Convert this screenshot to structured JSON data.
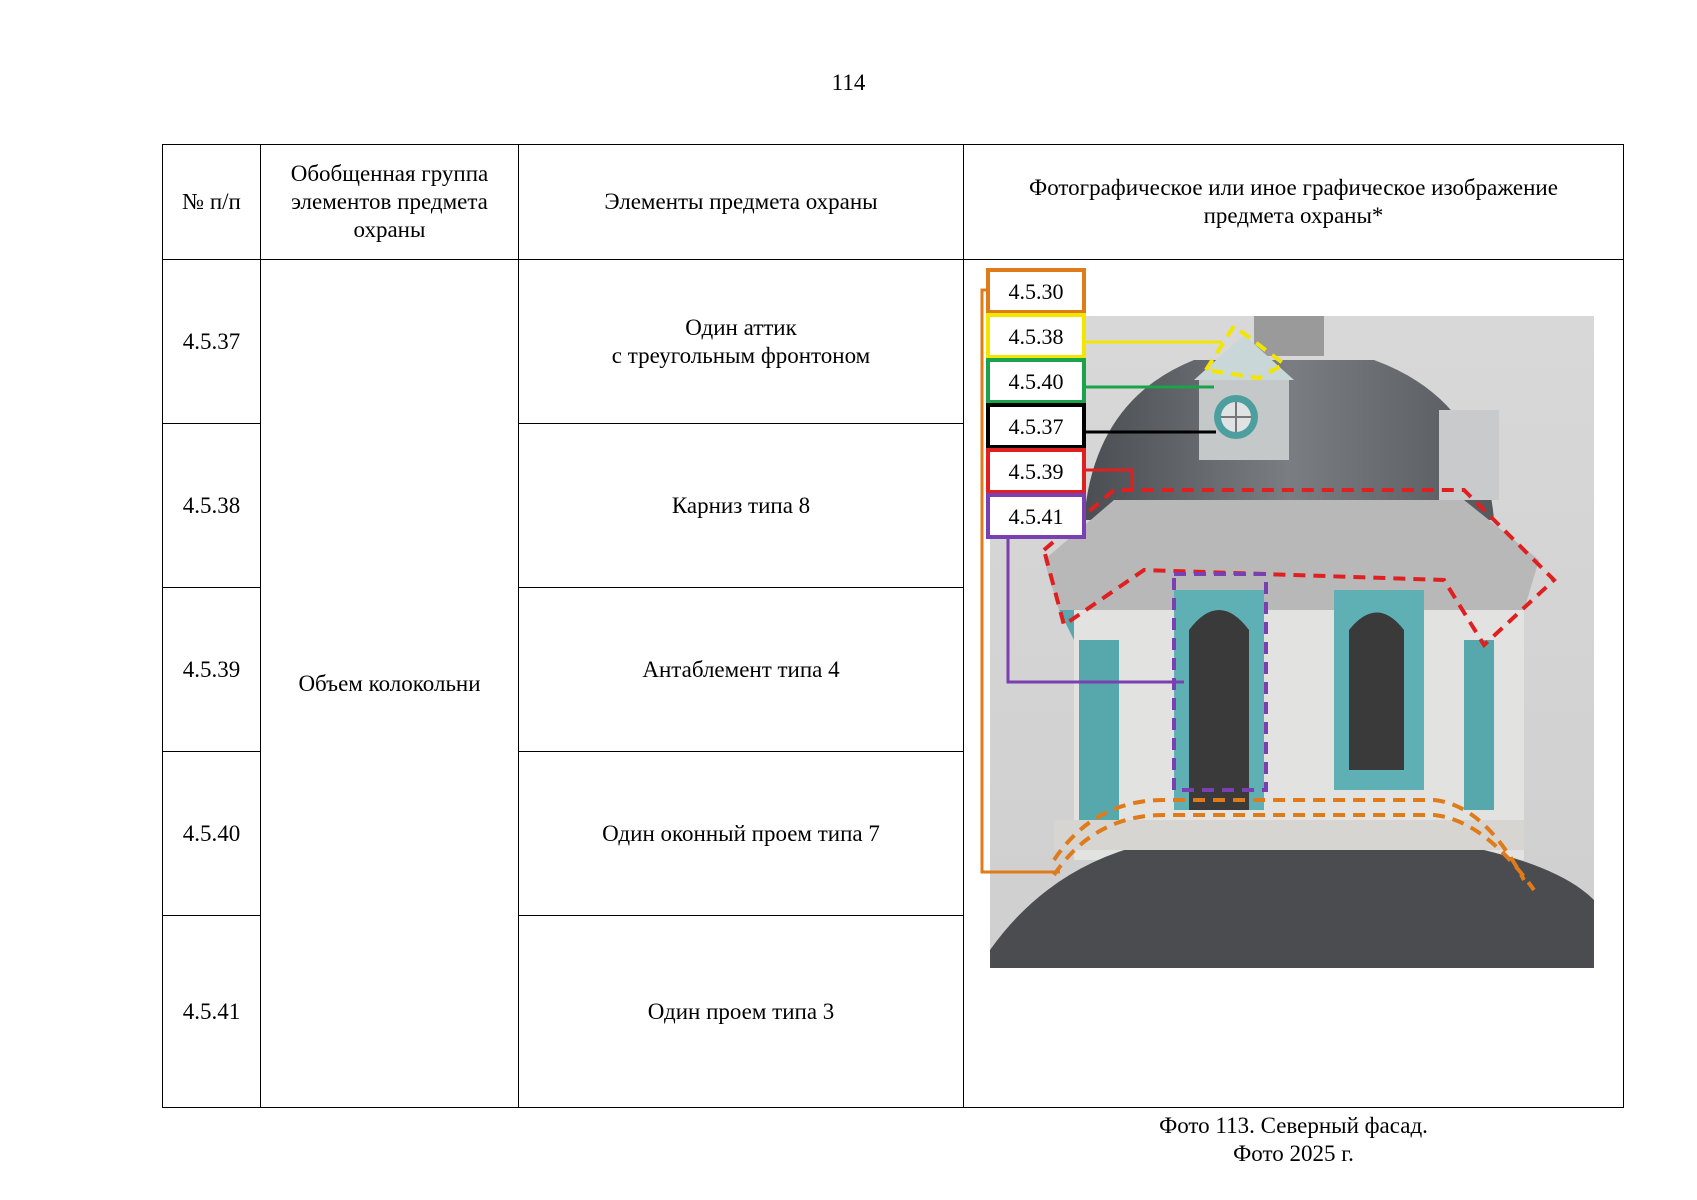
{
  "page_number": "114",
  "header": {
    "col_num": "№ п/п",
    "col_group": "Обобщенная группа элементов предмета охраны",
    "col_elements": "Элементы предмета охраны",
    "col_photo": "Фотографическое или иное графическое изображение предмета охраны*"
  },
  "group_name": "Объем колокольни",
  "rows": [
    {
      "num": "4.5.37",
      "element_line1": "Один аттик",
      "element_line2": "с треугольным фронтоном"
    },
    {
      "num": "4.5.38",
      "element": "Карниз типа 8"
    },
    {
      "num": "4.5.39",
      "element": "Антаблемент типа 4"
    },
    {
      "num": "4.5.40",
      "element": "Один оконный проем типа 7"
    },
    {
      "num": "4.5.41",
      "element": "Один проем типа 3"
    }
  ],
  "photo_labels": [
    {
      "text": "4.5.30",
      "color": "#e07b1a"
    },
    {
      "text": "4.5.38",
      "color": "#f2e600"
    },
    {
      "text": "4.5.40",
      "color": "#1aa34a"
    },
    {
      "text": "4.5.37",
      "color": "#000000"
    },
    {
      "text": "4.5.39",
      "color": "#e02020"
    },
    {
      "text": "4.5.41",
      "color": "#7a3fb0"
    }
  ],
  "caption_line1": "Фото 113. Северный фасад.",
  "caption_line2": "Фото 2025 г."
}
